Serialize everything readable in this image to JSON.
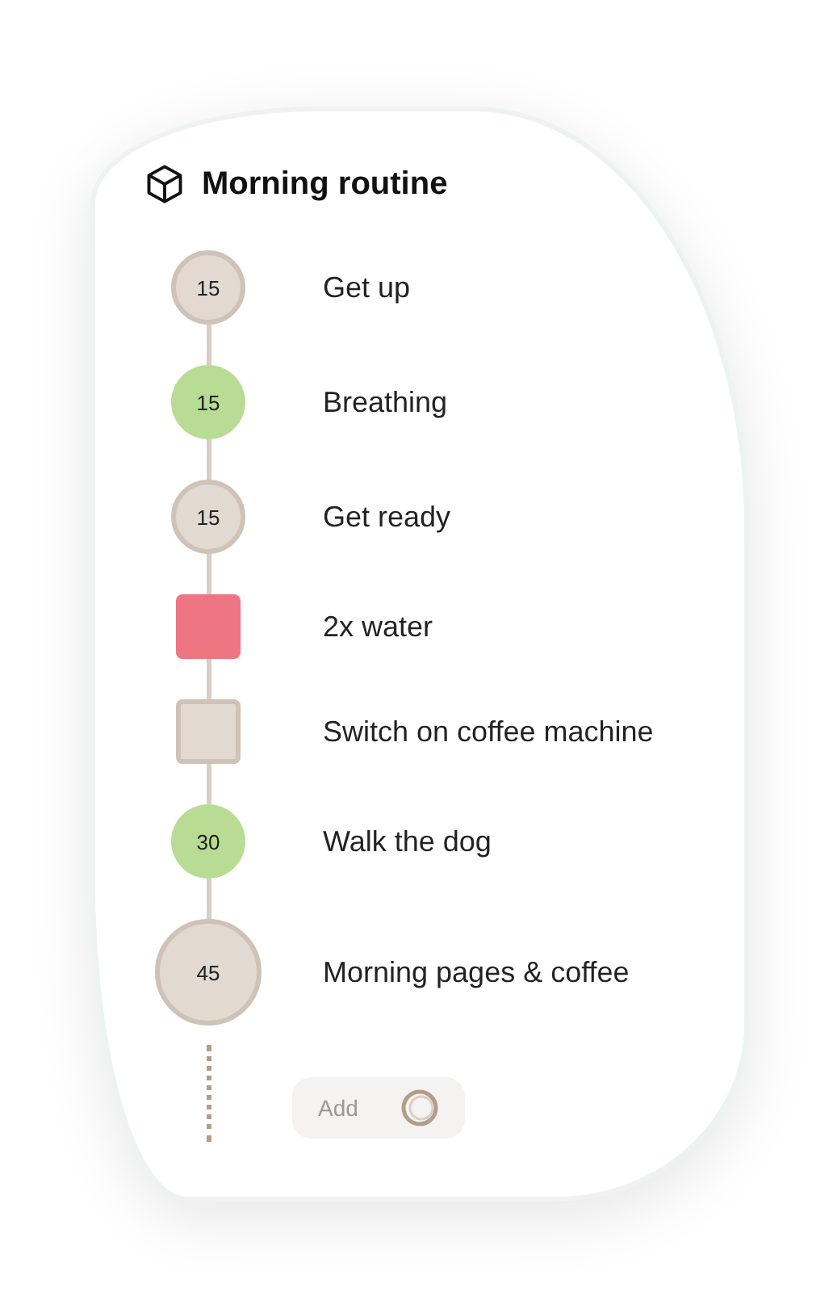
{
  "title": "Morning routine",
  "steps": [
    {
      "kind": "circle",
      "duration": "15",
      "color": "#e2d9d1",
      "label": "Get up"
    },
    {
      "kind": "circle",
      "duration": "15",
      "color": "#b9dc94",
      "label": "Breathing"
    },
    {
      "kind": "circle",
      "duration": "15",
      "color": "#e2d9d1",
      "label": "Get ready"
    },
    {
      "kind": "square",
      "color": "#ee7582",
      "label": "2x water"
    },
    {
      "kind": "square",
      "color": "#e2d9d1",
      "label": "Switch on coffee machine"
    },
    {
      "kind": "circle",
      "duration": "30",
      "color": "#b9dc94",
      "label": "Walk the dog"
    },
    {
      "kind": "big-circle",
      "duration": "45",
      "color": "#e2d9d1",
      "label": "Morning pages & coffee"
    }
  ],
  "add_button": {
    "label": "Add"
  }
}
